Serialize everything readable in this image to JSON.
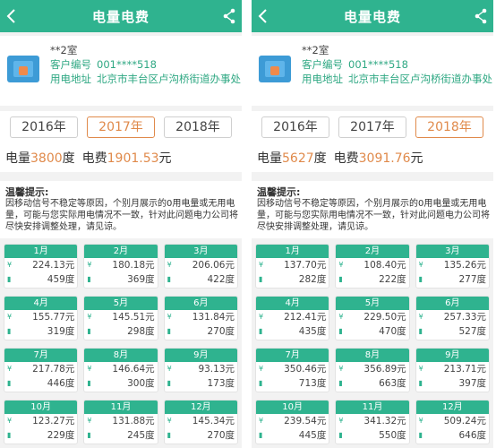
{
  "panels": [
    {
      "header_title": "电量电费",
      "account": {
        "name": "**2室",
        "id_label": "客户编号",
        "id_value": "001****518",
        "addr_label": "用电地址",
        "addr_value": "北京市丰台区卢沟桥街道办事处"
      },
      "years": [
        "2016年",
        "2017年",
        "2018年"
      ],
      "active_year": 1,
      "totals": {
        "power_label": "电量",
        "power_value": "3800",
        "power_unit": "度",
        "fee_label": "电费",
        "fee_value": "1901.53",
        "fee_unit": "元"
      },
      "notice": {
        "title": "温馨提示:",
        "text": "因移动信号不稳定等原因，个别月展示的0用电量或无用电量，可能与您实际用电情况不一致，针对此问题电力公司将尽快安排调整处理，请见谅。"
      },
      "months": [
        {
          "month": "1月",
          "fee": "224.13元",
          "power": "459度"
        },
        {
          "month": "2月",
          "fee": "180.18元",
          "power": "369度"
        },
        {
          "month": "3月",
          "fee": "206.06元",
          "power": "422度"
        },
        {
          "month": "4月",
          "fee": "155.77元",
          "power": "319度"
        },
        {
          "month": "5月",
          "fee": "145.51元",
          "power": "298度"
        },
        {
          "month": "6月",
          "fee": "131.84元",
          "power": "270度"
        },
        {
          "month": "7月",
          "fee": "217.78元",
          "power": "446度"
        },
        {
          "month": "8月",
          "fee": "146.64元",
          "power": "300度"
        },
        {
          "month": "9月",
          "fee": "93.13元",
          "power": "173度"
        },
        {
          "month": "10月",
          "fee": "123.27元",
          "power": "229度"
        },
        {
          "month": "11月",
          "fee": "131.88元",
          "power": "245度"
        },
        {
          "month": "12月",
          "fee": "145.34元",
          "power": "270度"
        }
      ]
    },
    {
      "header_title": "电量电费",
      "account": {
        "name": "**2室",
        "id_label": "客户编号",
        "id_value": "001****518",
        "addr_label": "用电地址",
        "addr_value": "北京市丰台区卢沟桥街道办事处"
      },
      "years": [
        "2016年",
        "2017年",
        "2018年"
      ],
      "active_year": 2,
      "totals": {
        "power_label": "电量",
        "power_value": "5627",
        "power_unit": "度",
        "fee_label": "电费",
        "fee_value": "3091.76",
        "fee_unit": "元"
      },
      "notice": {
        "title": "温馨提示:",
        "text": "因移动信号不稳定等原因，个别月展示的0用电量或无用电量，可能与您实际用电情况不一致，针对此问题电力公司将尽快安排调整处理，请见谅。"
      },
      "months": [
        {
          "month": "1月",
          "fee": "137.70元",
          "power": "282度"
        },
        {
          "month": "2月",
          "fee": "108.40元",
          "power": "222度"
        },
        {
          "month": "3月",
          "fee": "135.26元",
          "power": "277度"
        },
        {
          "month": "4月",
          "fee": "212.41元",
          "power": "435度"
        },
        {
          "month": "5月",
          "fee": "229.50元",
          "power": "470度"
        },
        {
          "month": "6月",
          "fee": "257.33元",
          "power": "527度"
        },
        {
          "month": "7月",
          "fee": "350.46元",
          "power": "713度"
        },
        {
          "month": "8月",
          "fee": "356.89元",
          "power": "663度"
        },
        {
          "month": "9月",
          "fee": "213.71元",
          "power": "397度"
        },
        {
          "month": "10月",
          "fee": "239.54元",
          "power": "445度"
        },
        {
          "month": "11月",
          "fee": "341.32元",
          "power": "550度"
        },
        {
          "month": "12月",
          "fee": "509.24元",
          "power": "646度"
        }
      ]
    }
  ],
  "colors": {
    "brand_green": "#2fb38f",
    "accent_orange": "#e08a4b"
  },
  "icons": {
    "fee": "yen-icon",
    "power": "battery-icon",
    "back": "chevron-left-icon",
    "share": "share-icon",
    "house": "house-card-icon"
  }
}
